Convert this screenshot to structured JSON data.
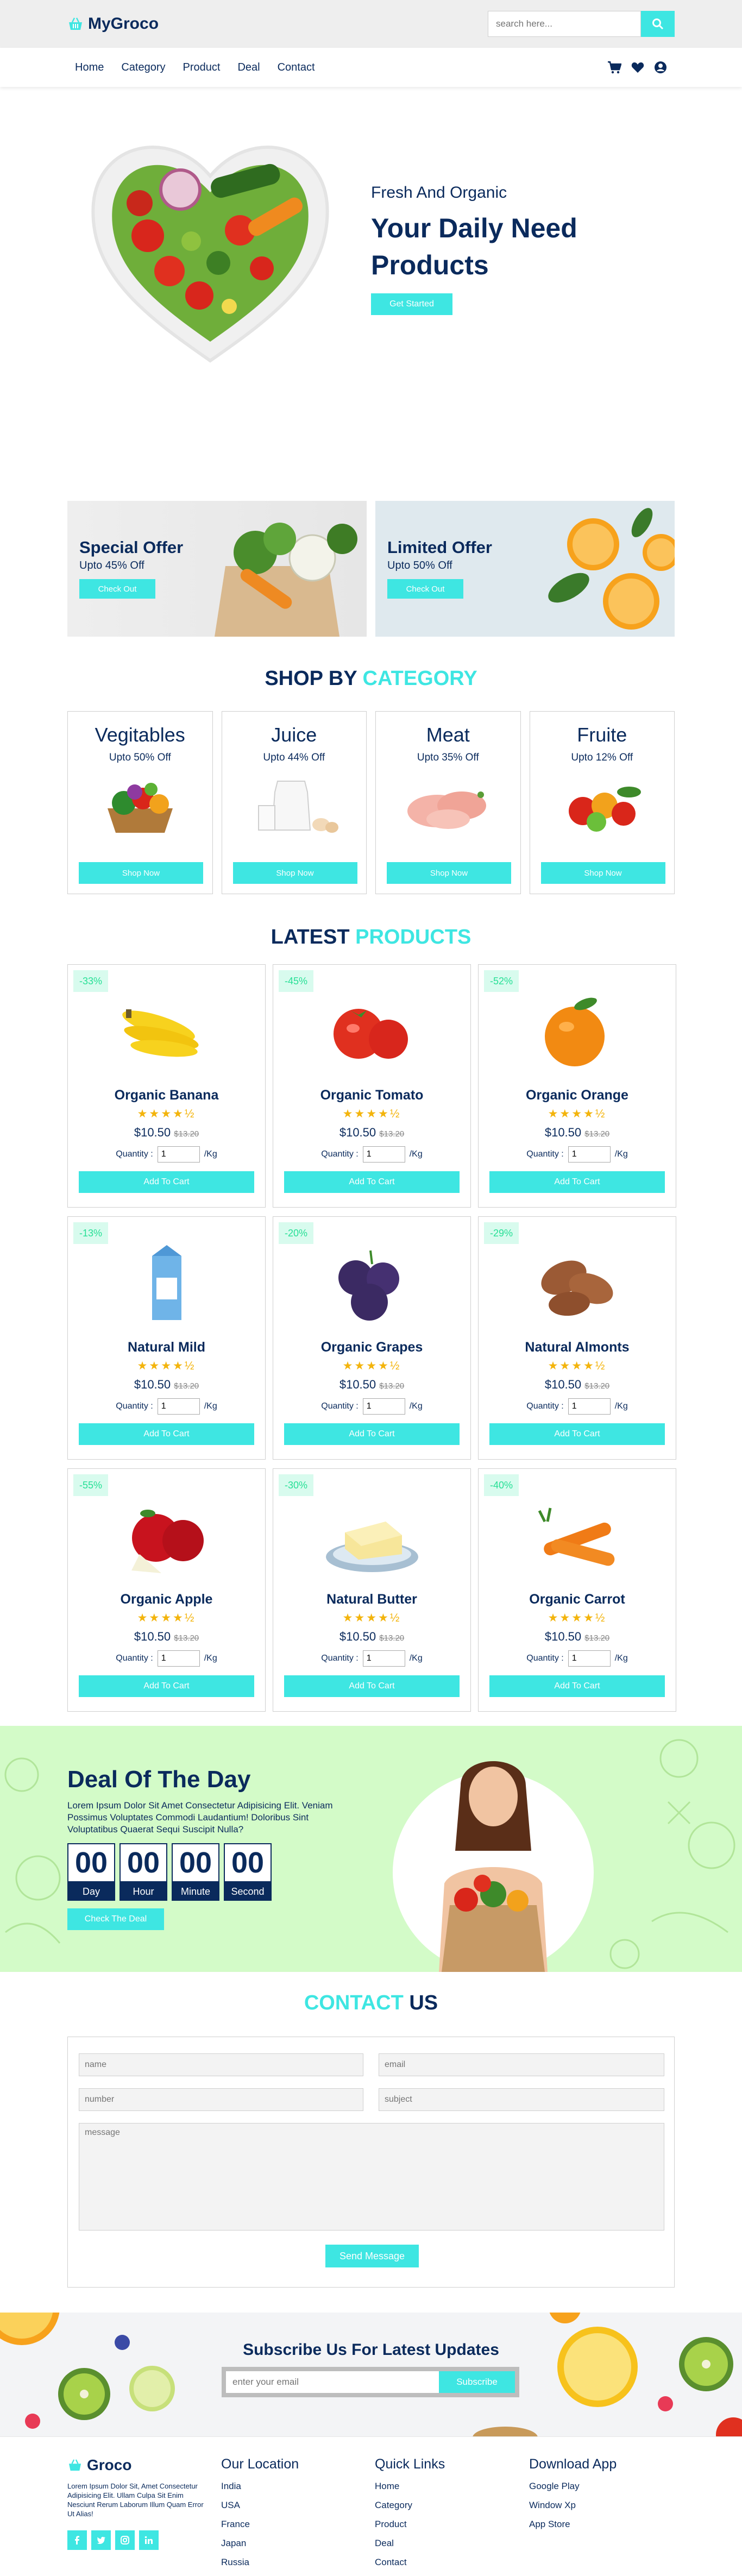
{
  "header": {
    "brand": "MyGroco",
    "search_placeholder": "search here..."
  },
  "nav": {
    "items": [
      "Home",
      "Category",
      "Product",
      "Deal",
      "Contact"
    ]
  },
  "hero": {
    "subtitle": "Fresh And Organic",
    "title": "Your Daily Need Products",
    "button": "Get Started"
  },
  "offers": [
    {
      "title": "Special Offer",
      "subtitle": "Upto 45% Off",
      "button": "Check Out"
    },
    {
      "title": "Limited Offer",
      "subtitle": "Upto 50% Off",
      "button": "Check Out"
    }
  ],
  "categories": {
    "title_a": "SHOP BY",
    "title_b": "CATEGORY",
    "items": [
      {
        "name": "Vegitables",
        "offer": "Upto 50% Off",
        "button": "Shop Now"
      },
      {
        "name": "Juice",
        "offer": "Upto 44% Off",
        "button": "Shop Now"
      },
      {
        "name": "Meat",
        "offer": "Upto 35% Off",
        "button": "Shop Now"
      },
      {
        "name": "Fruite",
        "offer": "Upto 12% Off",
        "button": "Shop Now"
      }
    ]
  },
  "products": {
    "title_a": "LATEST",
    "title_b": "PRODUCTS",
    "quantity_label": "Quantity :",
    "unit": "/Kg",
    "qty_value": "1",
    "button": "Add To Cart",
    "items": [
      {
        "name": "Organic Banana",
        "discount": "-33%",
        "price": "$10.50",
        "old_price": "$13.20",
        "stars": "★★★★½"
      },
      {
        "name": "Organic Tomato",
        "discount": "-45%",
        "price": "$10.50",
        "old_price": "$13.20",
        "stars": "★★★★½"
      },
      {
        "name": "Organic Orange",
        "discount": "-52%",
        "price": "$10.50",
        "old_price": "$13.20",
        "stars": "★★★★½"
      },
      {
        "name": "Natural Mild",
        "discount": "-13%",
        "price": "$10.50",
        "old_price": "$13.20",
        "stars": "★★★★½"
      },
      {
        "name": "Organic Grapes",
        "discount": "-20%",
        "price": "$10.50",
        "old_price": "$13.20",
        "stars": "★★★★½"
      },
      {
        "name": "Natural Almonts",
        "discount": "-29%",
        "price": "$10.50",
        "old_price": "$13.20",
        "stars": "★★★★½"
      },
      {
        "name": "Organic Apple",
        "discount": "-55%",
        "price": "$10.50",
        "old_price": "$13.20",
        "stars": "★★★★½"
      },
      {
        "name": "Natural Butter",
        "discount": "-30%",
        "price": "$10.50",
        "old_price": "$13.20",
        "stars": "★★★★½"
      },
      {
        "name": "Organic Carrot",
        "discount": "-40%",
        "price": "$10.50",
        "old_price": "$13.20",
        "stars": "★★★★½"
      }
    ]
  },
  "deal": {
    "title": "Deal Of The Day",
    "text": "Lorem Ipsum Dolor Sit Amet Consectetur Adipisicing Elit. Veniam Possimus Voluptates Commodi Laudantium! Doloribus Sint Voluptatibus Quaerat Sequi Suscipit Nulla?",
    "timer": [
      {
        "value": "00",
        "label": "Day"
      },
      {
        "value": "00",
        "label": "Hour"
      },
      {
        "value": "00",
        "label": "Minute"
      },
      {
        "value": "00",
        "label": "Second"
      }
    ],
    "button": "Check The Deal"
  },
  "contact": {
    "title_a": "CONTACT",
    "title_b": "US",
    "name_ph": "name",
    "email_ph": "email",
    "number_ph": "number",
    "subject_ph": "subject",
    "message_ph": "message",
    "button": "Send Message"
  },
  "newsletter": {
    "title": "Subscribe Us For Latest Updates",
    "placeholder": "enter your email",
    "button": "Subscribe"
  },
  "footer": {
    "brand": "Groco",
    "about": "Lorem Ipsum Dolor Sit, Amet Consectetur Adipisicing Elit. Ullam Culpa Sit Enim Nesciunt Rerum Laborum Illum Quam Error Ut Alias!",
    "location_title": "Our Location",
    "locations": [
      "India",
      "USA",
      "France",
      "Japan",
      "Russia"
    ],
    "links_title": "Quick Links",
    "links": [
      "Home",
      "Category",
      "Product",
      "Deal",
      "Contact"
    ],
    "download_title": "Download App",
    "downloads": [
      "Google Play",
      "Window Xp",
      "App Store"
    ]
  },
  "colors": {
    "accent": "#3ee6e2",
    "navy": "#0a2a5c",
    "deal_bg": "#d3fbc8",
    "discount_text": "#27e096"
  }
}
